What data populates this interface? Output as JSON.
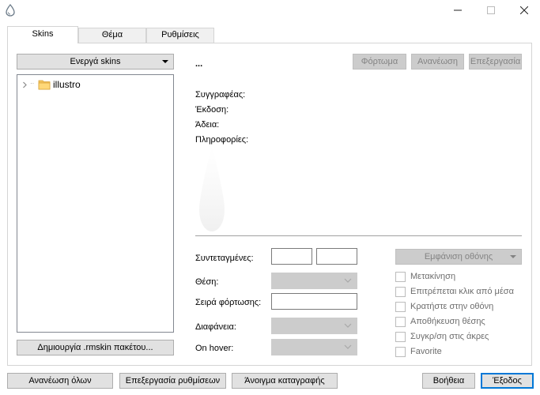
{
  "window": {
    "icon": "rainmeter-drop-icon",
    "controls": [
      "minimize-icon",
      "maximize-icon",
      "close-icon"
    ]
  },
  "tabs": [
    {
      "label": "Skins",
      "active": true
    },
    {
      "label": "Θέμα",
      "active": false
    },
    {
      "label": "Ρυθμίσεις",
      "active": false
    }
  ],
  "skins_panel": {
    "active_skins_dropdown": "Ενεργά skins",
    "tree": [
      {
        "label": "illustro",
        "icon": "folder-icon",
        "expander": "chevron-right-icon"
      }
    ],
    "create_package_button": "Δημιουργία .rmskin πακέτου..."
  },
  "details": {
    "skin_name": "...",
    "load_button": "Φόρτωμα",
    "refresh_button": "Ανανέωση",
    "edit_button": "Επεξεργασία",
    "author_label": "Συγγραφέας:",
    "version_label": "Έκδοση:",
    "license_label": "Άδεια:",
    "info_label": "Πληροφορίες:"
  },
  "settings": {
    "coordinates_label": "Συντεταγμένες:",
    "coord_x": "",
    "coord_y": "",
    "display_button": "Εμφάνιση οθόνης",
    "position_label": "Θέση:",
    "load_order_label": "Σειρά φόρτωσης:",
    "load_order_value": "",
    "transparency_label": "Διαφάνεια:",
    "on_hover_label": "On hover:",
    "checkboxes": [
      {
        "label": "Μετακίνηση",
        "checked": false
      },
      {
        "label": "Επιτρέπεται κλικ από μέσα",
        "checked": false
      },
      {
        "label": "Κρατήστε στην οθόνη",
        "checked": false
      },
      {
        "label": "Αποθήκευση θέσης",
        "checked": false
      },
      {
        "label": "Συγκρ/ση στις άκρες",
        "checked": false
      },
      {
        "label": "Favorite",
        "checked": false
      }
    ]
  },
  "footer": {
    "refresh_all": "Ανανέωση όλων",
    "edit_settings": "Επεξεργασία ρυθμίσεων",
    "open_log": "Άνοιγμα καταγραφής",
    "help": "Βοήθεια",
    "exit": "Έξοδος"
  },
  "colors": {
    "accent": "#0078d7",
    "button_face": "#e1e1e1",
    "disabled_face": "#cccccc",
    "disabled_text": "#838383"
  }
}
